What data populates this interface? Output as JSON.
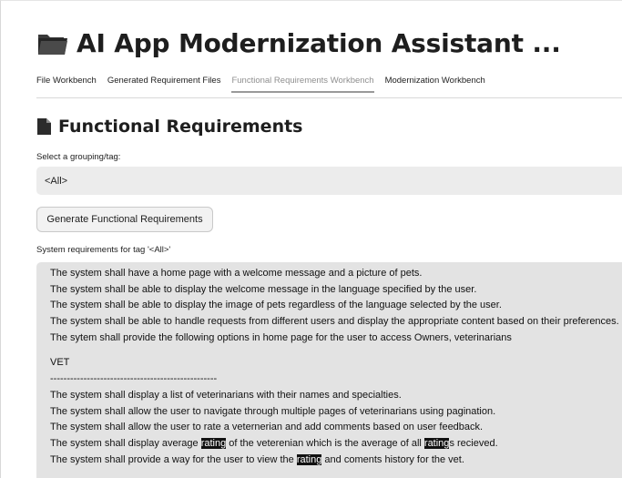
{
  "app": {
    "title": "AI App Modernization Assistant ..."
  },
  "tabs": [
    {
      "label": "File Workbench",
      "active": false
    },
    {
      "label": "Generated Requirement Files",
      "active": false
    },
    {
      "label": "Functional Requirements Workbench",
      "active": true
    },
    {
      "label": "Modernization Workbench",
      "active": false
    }
  ],
  "section": {
    "title": "Functional Requirements"
  },
  "grouping": {
    "label": "Select a grouping/tag:",
    "selected": "<All>"
  },
  "generate_button": "Generate Functional Requirements",
  "requirements": {
    "label": "System requirements for tag '<All>'",
    "lines_top": [
      "The system shall have a home page with a welcome message and a picture of pets.",
      "The system shall be able to display the welcome message in the language specified by the user.",
      "The system shall be able to display the image of pets regardless of the language selected by the user.",
      "The system shall be able to handle requests from different users and display the appropriate content based on their preferences.",
      "The sytem shall provide the following options in home page for the user to access Owners, veterinarians"
    ],
    "vet_heading": "VET",
    "divider": "--------------------------------------------------",
    "vet_lines": [
      "The system shall display a list of veterinarians with their names and specialties.",
      "The system shall allow the user to navigate through multiple pages of veterinarians using pagination.",
      "The system shall allow the user to rate a veternerian and add comments based on user feedback."
    ],
    "rating_line": {
      "part1": "The system shall display average ",
      "hl1": "rating",
      "part2": " of the veterenian which is the average of all ",
      "hl2": "rating",
      "part3": "s recieved."
    },
    "history_line": {
      "part1": "The system shall provide a way for the user to view the ",
      "hl": "rating",
      "part2": " and coments history for the vet."
    }
  },
  "colors": {
    "select_bg": "#ececec",
    "textarea_bg": "#e3e3e3",
    "highlight": "#111111"
  }
}
